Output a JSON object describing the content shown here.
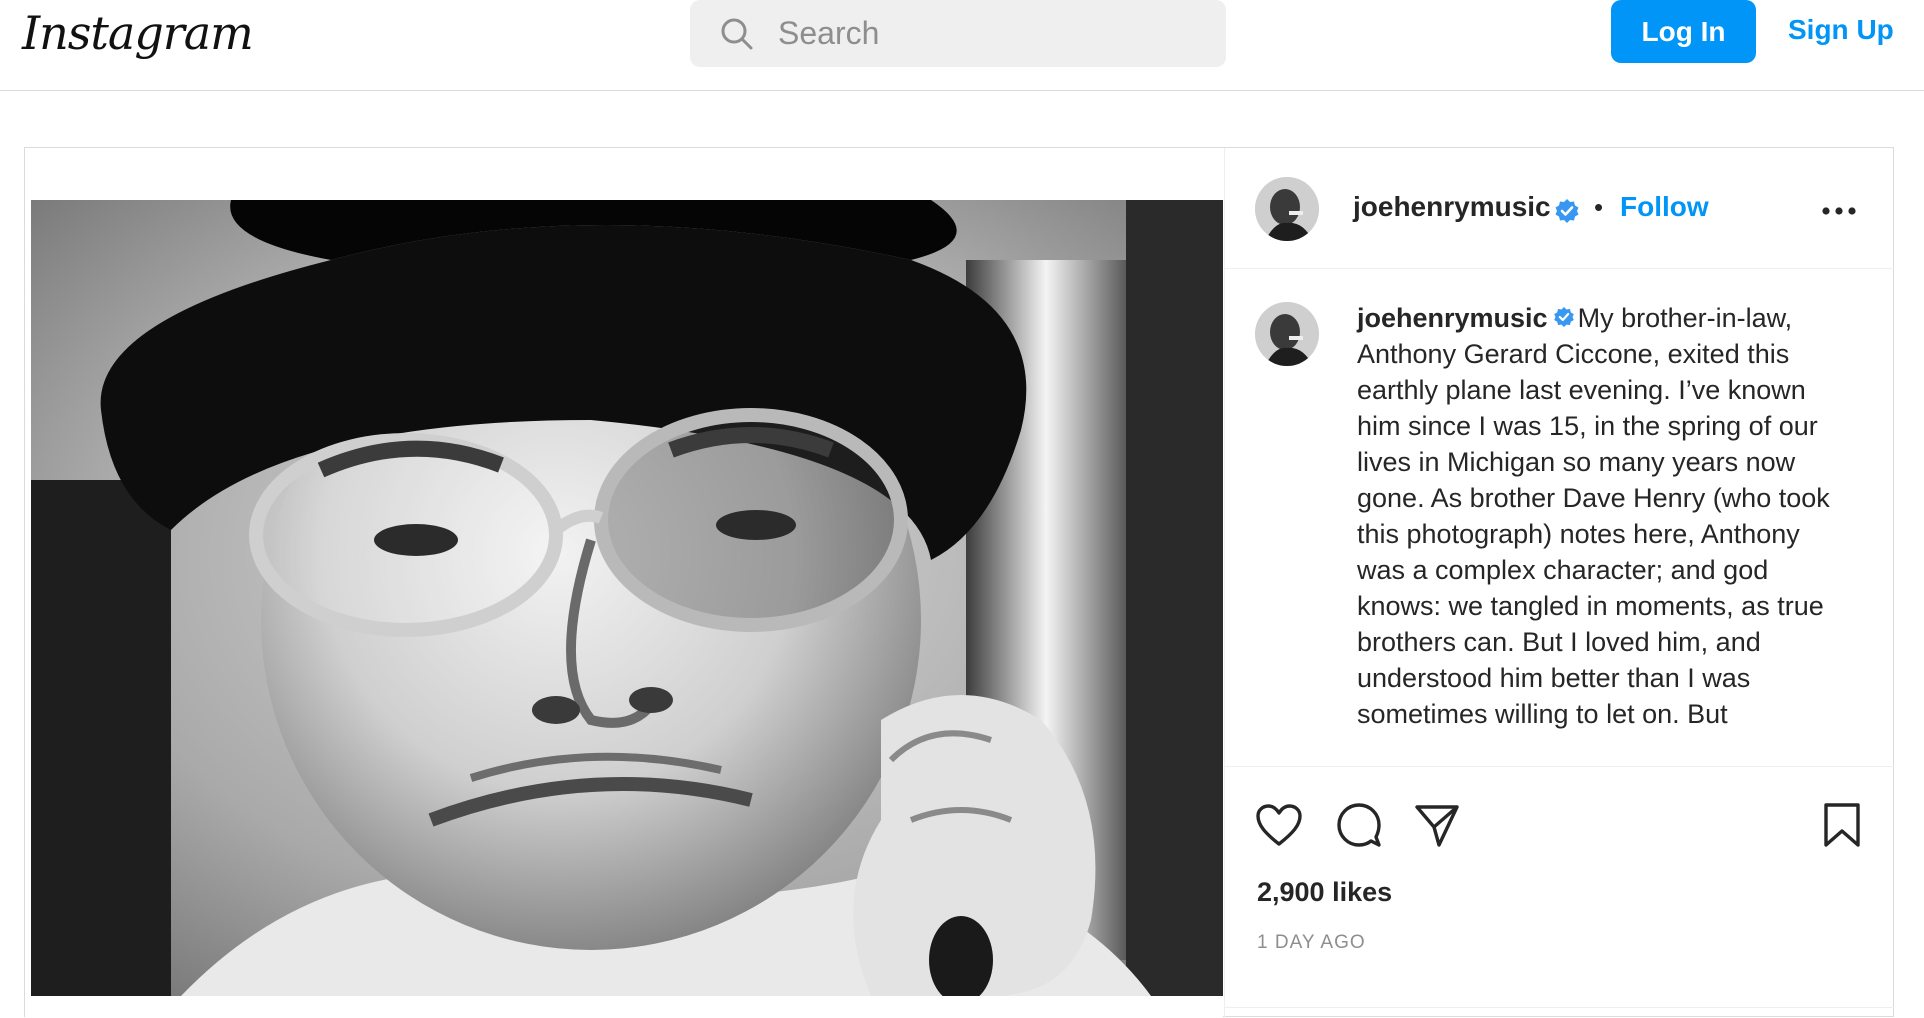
{
  "header": {
    "logo_text": "Instagram",
    "search_placeholder": "Search",
    "login_label": "Log In",
    "signup_label": "Sign Up"
  },
  "post": {
    "username": "joehenrymusic",
    "verified": true,
    "separator": "•",
    "follow_label": "Follow",
    "caption": {
      "username": "joehenrymusic",
      "text": "My brother-in-law, Anthony Gerard Ciccone, exited this earthly plane last evening. I’ve known him since I was 15, in the spring of our lives in Michigan so many years now gone. As brother Dave Henry (who took this photograph) notes here, Anthony was a complex character; and god knows: we tangled in moments, as true brothers can. But I loved him, and understood him better than I was sometimes willing to let on. But"
    },
    "likes": "2,900 likes",
    "timestamp": "1 DAY AGO",
    "photo": {
      "style": "black-and-white portrait",
      "alt": "Black and white portrait of a man in a hat and glasses"
    }
  },
  "icons": {
    "search": "search-icon",
    "verified": "verified-badge-icon",
    "more": "more-options-icon",
    "like": "heart-icon",
    "comment": "comment-icon",
    "share": "share-icon",
    "save": "bookmark-icon"
  },
  "colors": {
    "accent": "#0095f6",
    "text": "#262626",
    "muted": "#8e8e8e",
    "border": "#dbdbdb",
    "search_bg": "#efefef"
  }
}
